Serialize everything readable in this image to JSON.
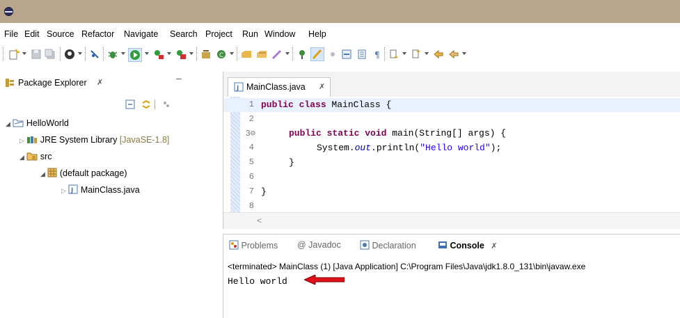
{
  "menu": [
    "File",
    "Edit",
    "Source",
    "Refactor",
    "Navigate",
    "Search",
    "Project",
    "Run",
    "Window",
    "Help"
  ],
  "package_explorer": {
    "title": "Package Explorer",
    "tab_close": "✗",
    "minimize": "–",
    "project": "HelloWorld",
    "jre_label": "JRE System Library",
    "jre_version": "[JavaSE-1.8]",
    "src": "src",
    "package": "(default package)",
    "file": "MainClass.java"
  },
  "editor": {
    "tab_title": "MainClass.java",
    "tab_close": "✗",
    "line_numbers": [
      "1",
      "2",
      "3⊖",
      "4",
      "5",
      "6",
      "7",
      "8"
    ],
    "line1_kw": "public class",
    "line1_rest": " MainClass {",
    "line3_kw": "public static void",
    "line3_rest": " main(String[] args) {",
    "line4_a": "System.",
    "line4_field": "out",
    "line4_b": ".println(",
    "line4_str": "\"Hello world\"",
    "line4_c": ");",
    "line5": "}",
    "line7": "}",
    "scroll_left": "<"
  },
  "console": {
    "tabs": [
      "Problems",
      "@ Javadoc",
      "Declaration",
      "Console"
    ],
    "console_close": "✗",
    "status": "<terminated> MainClass (1) [Java Application] C:\\Program Files\\Java\\jdk1.8.0_131\\bin\\javaw.exe",
    "output": "Hello world"
  },
  "colors": {
    "titlebar": "#b9a58c",
    "arrow": "#e0101a",
    "run_green": "#2f9e3a",
    "keyword": "#7f0055",
    "string": "#2a00ff"
  }
}
